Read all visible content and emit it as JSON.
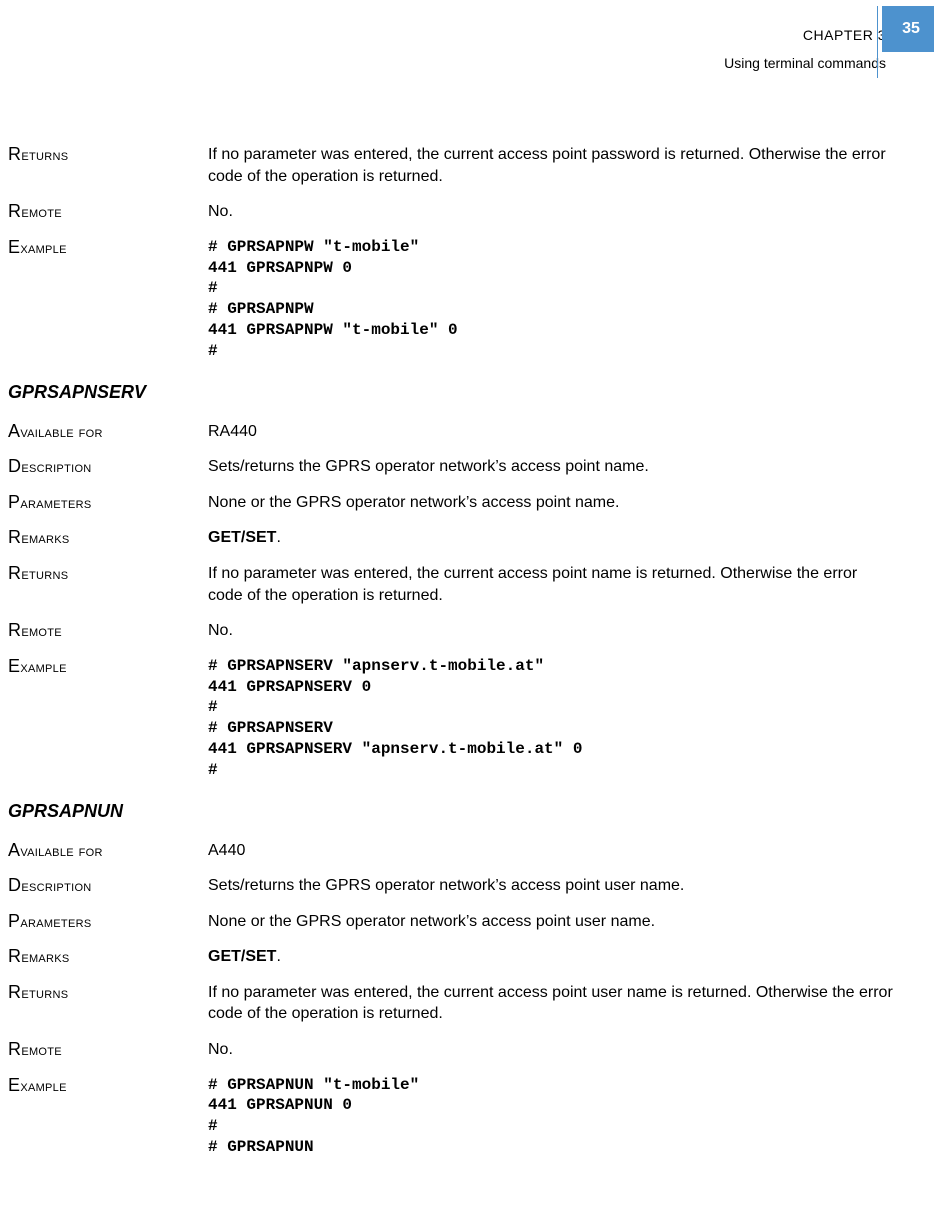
{
  "header": {
    "chapter": "CHAPTER 3",
    "subtitle": "Using terminal commands",
    "page_number": "35"
  },
  "sections": [
    {
      "rows": [
        {
          "label": "Returns",
          "type": "text",
          "value": "If no parameter was entered, the current access point password is returned. Otherwise the error code of the operation is returned."
        },
        {
          "label": "Remote",
          "type": "text",
          "value": "No."
        },
        {
          "label": "Example",
          "type": "code",
          "value": "# GPRSAPNPW \"t-mobile\"\n441 GPRSAPNPW 0\n#\n# GPRSAPNPW\n441 GPRSAPNPW \"t-mobile\" 0\n#"
        }
      ]
    },
    {
      "heading": "GPRSAPNSERV",
      "rows": [
        {
          "label": "Available for",
          "type": "text",
          "value": "RA440"
        },
        {
          "label": "Description",
          "type": "text",
          "value": "Sets/returns the GPRS operator network’s access point name."
        },
        {
          "label": "Parameters",
          "type": "text",
          "value": "None or the GPRS operator network’s access point name."
        },
        {
          "label": "Remarks",
          "type": "remarks",
          "bold": "GET/SET",
          "suffix": "."
        },
        {
          "label": "Returns",
          "type": "text",
          "value": "If no parameter was entered, the current access point name is returned. Otherwise the error code of the operation is returned."
        },
        {
          "label": "Remote",
          "type": "text",
          "value": "No."
        },
        {
          "label": "Example",
          "type": "code",
          "value": "# GPRSAPNSERV \"apnserv.t-mobile.at\"\n441 GPRSAPNSERV 0\n#\n# GPRSAPNSERV\n441 GPRSAPNSERV \"apnserv.t-mobile.at\" 0\n#"
        }
      ]
    },
    {
      "heading": "GPRSAPNUN",
      "rows": [
        {
          "label": "Available for",
          "type": "text",
          "value": "A440"
        },
        {
          "label": "Description",
          "type": "text",
          "value": "Sets/returns the GPRS operator network’s access point user name."
        },
        {
          "label": "Parameters",
          "type": "text",
          "value": "None or the GPRS operator network’s access point user name."
        },
        {
          "label": "Remarks",
          "type": "remarks",
          "bold": "GET/SET",
          "suffix": "."
        },
        {
          "label": "Returns",
          "type": "text",
          "value": "If no parameter was entered, the current access point user name is returned. Otherwise the error code of the operation is returned."
        },
        {
          "label": "Remote",
          "type": "text",
          "value": "No."
        },
        {
          "label": "Example",
          "type": "code",
          "value": "# GPRSAPNUN \"t-mobile\"\n441 GPRSAPNUN 0\n#\n# GPRSAPNUN"
        }
      ]
    }
  ]
}
